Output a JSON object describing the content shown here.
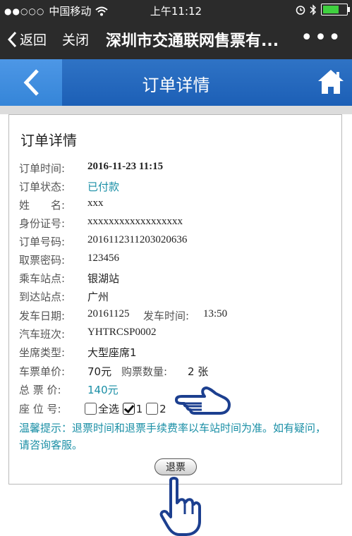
{
  "status_bar": {
    "signal": "●●○○○",
    "carrier": "中国移动",
    "time": "上午11:12"
  },
  "nav": {
    "back_label": "返回",
    "close_label": "关闭",
    "title": "深圳市交通联网售票有...",
    "more_label": "•••"
  },
  "header": {
    "title": "订单详情"
  },
  "order": {
    "title": "订单详情",
    "fields": {
      "order_time": {
        "label": "订单时间:",
        "value": "2016-11-23 11:15"
      },
      "order_status": {
        "label": "订单状态:",
        "value": "已付款"
      },
      "name": {
        "label": "姓　　名:",
        "value": "xxx"
      },
      "id_number": {
        "label": "身份证号:",
        "value": "xxxxxxxxxxxxxxxxxx"
      },
      "order_number": {
        "label": "订单号码:",
        "value": "201611231120302​0636"
      },
      "pickup_code": {
        "label": "取票密码:",
        "value": "123456"
      },
      "departure_station": {
        "label": "乘车站点:",
        "value": "银湖站"
      },
      "arrival_station": {
        "label": "到达站点:",
        "value": "广州"
      },
      "departure_date": {
        "label": "发车日期:",
        "value": "20161125"
      },
      "departure_time": {
        "label": "发车时间:",
        "value": "13:50"
      },
      "bus_number": {
        "label": "汽车班次:",
        "value": "YHTRCSP0002"
      },
      "seat_type": {
        "label": "坐席类型:",
        "value": "大型座席1"
      },
      "unit_price": {
        "label": "车票单价:",
        "value": "70元"
      },
      "quantity": {
        "label": "购票数量:",
        "value": "2 张"
      },
      "total_price": {
        "label": "总 票 价:",
        "value": "140元"
      },
      "seat_number": {
        "label": "座 位 号:"
      }
    },
    "seats": {
      "select_all_label": "全选",
      "seat1_label": "1",
      "seat2_label": "2",
      "seat1_checked": true,
      "seat2_checked": false
    },
    "tip": "温馨提示：退票时间和退票手续费率以车站时间为准。如有疑问，请咨询客服。",
    "refund_button": "退票"
  }
}
